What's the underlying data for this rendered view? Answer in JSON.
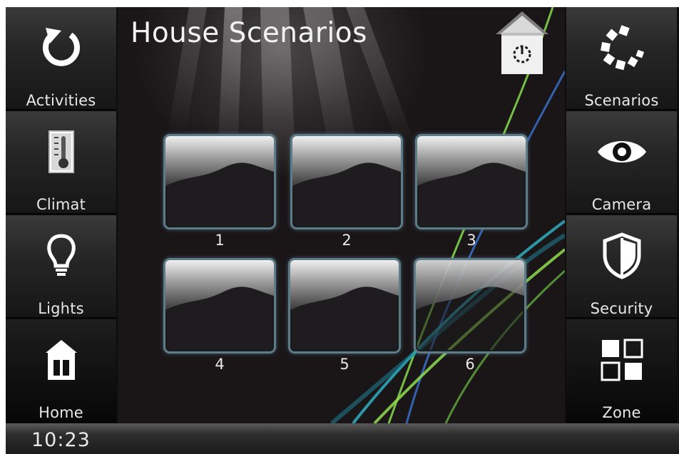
{
  "page_title": "House Scenarios",
  "left_nav": [
    {
      "label": "Activities",
      "icon": "refresh-icon"
    },
    {
      "label": "Climat",
      "icon": "thermometer-icon"
    },
    {
      "label": "Lights",
      "icon": "lightbulb-icon"
    },
    {
      "label": "Home",
      "icon": "house-icon"
    }
  ],
  "right_nav": [
    {
      "label": "Scenarios",
      "icon": "spinner-icon"
    },
    {
      "label": "Camera",
      "icon": "eye-icon"
    },
    {
      "label": "Security",
      "icon": "shield-icon"
    },
    {
      "label": "Zone",
      "icon": "grid-icon"
    }
  ],
  "scenarios": [
    {
      "label": "1"
    },
    {
      "label": "2"
    },
    {
      "label": "3"
    },
    {
      "label": "4"
    },
    {
      "label": "5"
    },
    {
      "label": "6"
    }
  ],
  "header_icon": "house-power-icon",
  "status_bar": {
    "time": "10:23"
  },
  "colors": {
    "tile_border": "#5d7c8a",
    "streak_green": "#7fd14a",
    "streak_blue": "#3a6fc9",
    "streak_cyan": "#2fb7c9"
  }
}
